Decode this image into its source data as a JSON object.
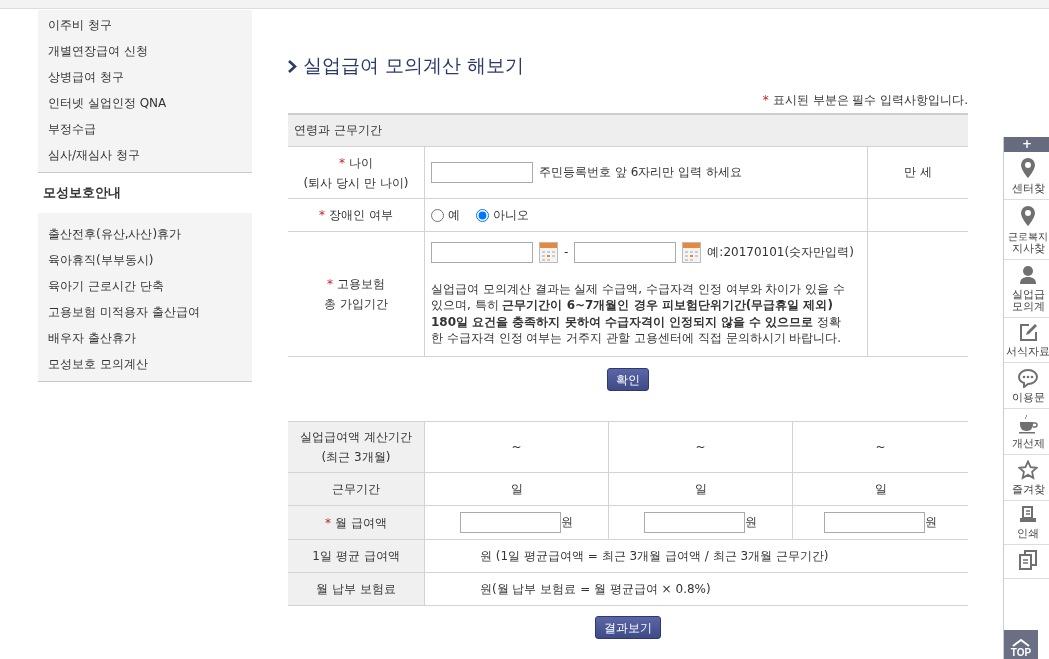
{
  "sidebar": {
    "items_top": [
      {
        "label": "이주비 청구"
      },
      {
        "label": "개별연장급여 신청"
      },
      {
        "label": "상병급여 청구"
      },
      {
        "label": "인터넷 실업인정 QNA"
      },
      {
        "label": "부정수급"
      },
      {
        "label": "심사/재심사 청구"
      }
    ],
    "heading": "모성보호안내",
    "items": [
      {
        "label": "출산전후(유산,사산)휴가"
      },
      {
        "label": "육아휴직(부부동시)"
      },
      {
        "label": "육아기 근로시간 단축"
      },
      {
        "label": "고용보험 미적용자 출산급여"
      },
      {
        "label": "배우자 출산휴가"
      },
      {
        "label": "모성보호 모의계산"
      }
    ]
  },
  "page_title": "실업급여 모의계산 해보기",
  "required_note": {
    "mark": "*",
    "text": "표시된 부분은 필수 입력사항입니다."
  },
  "section_title": "연령과 근무기간",
  "form_rows": [
    {
      "kind": "age",
      "mark": "*",
      "label": "나이",
      "sublabel": "(퇴사 당시 만 나이)",
      "hint": "주민등록번호 앞 6자리만 입력 하세요",
      "result": "만 세"
    },
    {
      "kind": "radio",
      "mark": "*",
      "label": "장애인 여부",
      "options": [
        {
          "label": "예",
          "selected": false
        },
        {
          "label": "아니오",
          "selected": true
        }
      ]
    },
    {
      "kind": "period",
      "mark": "*",
      "label": "고용보험",
      "sublabel": "총 가입기간",
      "separator": "-",
      "example": "예:20170101(숫자만입력)",
      "notice": "실업급여 모의계산 결과는 실제 수급액, 수급자격 인정 여부와 차이가 있을 수 있으며, 특히 **근무기간이 6~7개월인 경우 피보험단위기간(무급휴일 제외) 180일 요건을 충족하지 못하여 수급자격이 인정되지 않을 수 있으므로** 정확한 수급자격 인정 여부는 거주지 관할 고용센터에 직접 문의하시기 바랍니다."
    }
  ],
  "confirm_button": "확인",
  "calc_rows": [
    {
      "kind": "cells",
      "label": "실업급여액 계산기간",
      "sublabel": "(최근 3개월)",
      "cells": [
        "~",
        "~",
        "~"
      ]
    },
    {
      "kind": "cells",
      "label": "근무기간",
      "cells": [
        "일",
        "일",
        "일"
      ]
    },
    {
      "kind": "inputs",
      "mark": "*",
      "label": "월 급여액",
      "cells": [
        "원",
        "원",
        "원"
      ]
    },
    {
      "kind": "span",
      "label": "1일 평균 급여액",
      "text": "원 (1일 평균급여액 = 최근 3개월 급여액 / 최근 3개월 근무기간)"
    },
    {
      "kind": "span",
      "label": "월 납부 보험료",
      "text": "원(월 납부 보험료 = 월 평균급여 × 0.8%)"
    }
  ],
  "result_button": "결과보기",
  "quick_menu": {
    "toggle": "+",
    "items": [
      {
        "kind": "pin",
        "lines": [
          "센터찾"
        ]
      },
      {
        "kind": "pin",
        "lines": [
          "근로복지",
          "지사찾"
        ]
      },
      {
        "kind": "person",
        "lines": [
          "실업급",
          "모의계"
        ]
      },
      {
        "kind": "edit",
        "lines": [
          "서식자료"
        ]
      },
      {
        "kind": "chat",
        "lines": [
          "이용문"
        ]
      },
      {
        "kind": "cup",
        "lines": [
          "개선제"
        ]
      },
      {
        "kind": "star",
        "lines": [
          "즐겨찾"
        ]
      },
      {
        "kind": "print",
        "lines": [
          "인쇄"
        ]
      },
      {
        "kind": "docs"
      }
    ],
    "top_button": "TOP"
  }
}
